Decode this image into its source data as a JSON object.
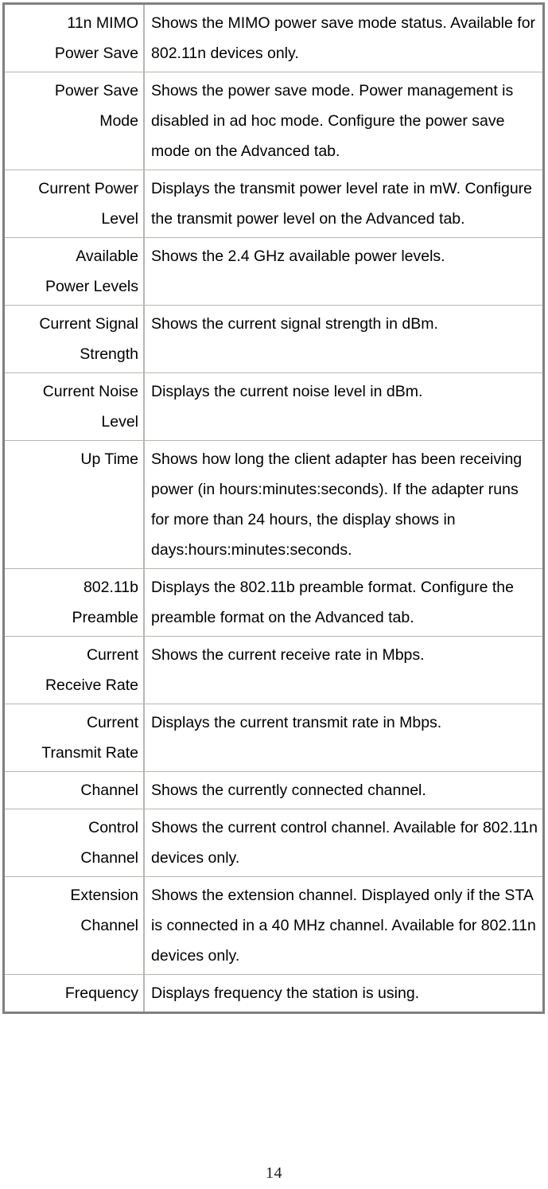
{
  "document": {
    "page_number": "14",
    "table": {
      "rows": [
        {
          "term": "11n MIMO Power Save",
          "term_lines": [
            "11n MIMO",
            "Power Save"
          ],
          "description": "Shows the MIMO power save mode status. Available for 802.11n devices only."
        },
        {
          "term": "Power Save Mode",
          "term_lines": [
            "Power Save",
            "Mode"
          ],
          "description": "Shows the power save mode. Power management is disabled in ad hoc mode. Configure the power save mode on the Advanced tab."
        },
        {
          "term": "Current Power Level",
          "term_lines": [
            "Current Power",
            "Level"
          ],
          "description": "Displays the transmit power level rate in mW. Configure the transmit power level on the Advanced tab."
        },
        {
          "term": "Available Power Levels",
          "term_lines": [
            "Available",
            "Power Levels"
          ],
          "description": "Shows the 2.4 GHz available power levels."
        },
        {
          "term": "Current Signal Strength",
          "term_lines": [
            "Current Signal",
            "Strength"
          ],
          "description": "Shows the current signal strength in dBm."
        },
        {
          "term": "Current Noise Level",
          "term_lines": [
            "Current Noise",
            "Level"
          ],
          "description": "Displays the current noise level in dBm."
        },
        {
          "term": "Up Time",
          "term_lines": [
            "Up Time"
          ],
          "description": "Shows how long the client adapter has been receiving power (in hours:minutes:seconds). If the adapter runs for more than 24 hours, the display shows in days:hours:minutes:seconds."
        },
        {
          "term": "802.11b Preamble",
          "term_lines": [
            "802.11b",
            "Preamble"
          ],
          "description": "Displays the 802.11b preamble format. Configure the preamble format on the Advanced tab."
        },
        {
          "term": "Current Receive Rate",
          "term_lines": [
            "Current",
            "Receive Rate"
          ],
          "description": "Shows the current receive rate in Mbps."
        },
        {
          "term": "Current Transmit Rate",
          "term_lines": [
            "Current",
            "Transmit Rate"
          ],
          "description": "Displays the current transmit rate in Mbps."
        },
        {
          "term": "Channel",
          "term_lines": [
            "Channel"
          ],
          "description": "Shows the currently connected channel."
        },
        {
          "term": "Control Channel",
          "term_lines": [
            "Control",
            "Channel"
          ],
          "description": "Shows the current control channel. Available for 802.11n devices only."
        },
        {
          "term": "Extension Channel",
          "term_lines": [
            "Extension",
            "Channel"
          ],
          "description": "Shows the extension channel. Displayed only if the STA is connected in a 40 MHz channel. Available for 802.11n devices only."
        },
        {
          "term": "Frequency",
          "term_lines": [
            "Frequency"
          ],
          "description": "Displays frequency the station is using."
        }
      ]
    }
  }
}
